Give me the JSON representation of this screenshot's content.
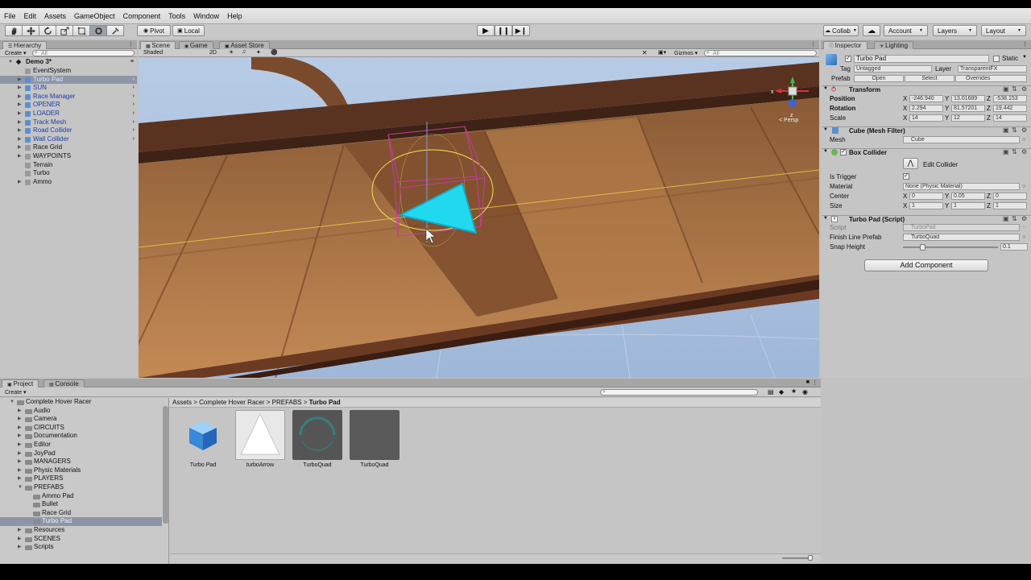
{
  "menu": [
    "File",
    "Edit",
    "Assets",
    "GameObject",
    "Component",
    "Tools",
    "Window",
    "Help"
  ],
  "toolbar": {
    "pivot_label": "Pivot",
    "local_label": "Local",
    "collab_label": "Collab",
    "account_label": "Account",
    "layers_label": "Layers",
    "layout_label": "Layout",
    "tools": [
      "hand-icon",
      "move-icon",
      "rotate-icon",
      "scale-icon",
      "rect-icon",
      "transform-icon"
    ]
  },
  "hierarchy": {
    "tab_label": "Hierarchy",
    "create_label": "Create",
    "search_placeholder": "All",
    "scene_name": "Demo 3*",
    "items": [
      {
        "label": "EventSystem",
        "color": "#111111"
      },
      {
        "label": "Turbo Pad",
        "color": "#1b3fa6"
      },
      {
        "label": "SUN",
        "color": "#1b3fa6"
      },
      {
        "label": "Race Manager",
        "color": "#1b3fa6"
      },
      {
        "label": "OPENER",
        "color": "#1b3fa6"
      },
      {
        "label": "LOADER",
        "color": "#1b3fa6"
      },
      {
        "label": "Track Mesh",
        "color": "#1b3fa6"
      },
      {
        "label": "Road Collider",
        "color": "#1b3fa6"
      },
      {
        "label": "Wall Collider",
        "color": "#1b3fa6"
      },
      {
        "label": "Race Grid",
        "color": "#111111"
      },
      {
        "label": "WAYPOINTS",
        "color": "#111111"
      },
      {
        "label": "Terrain",
        "color": "#111111"
      },
      {
        "label": "Turbo",
        "color": "#111111"
      },
      {
        "label": "Ammo",
        "color": "#111111"
      }
    ]
  },
  "scene_view": {
    "tabs": [
      "Scene",
      "Game",
      "Asset Store"
    ],
    "shading_mode": "Shaded",
    "mode_2d": "2D",
    "gizmos_label": "Gizmos",
    "search_placeholder": "All",
    "persp_label": "< Persp"
  },
  "inspector": {
    "tabs": [
      "Inspector",
      "Lighting"
    ],
    "object_name": "Turbo Pad",
    "static_label": "Static",
    "tag_label": "Tag",
    "tag_value": "Untagged",
    "layer_label": "Layer",
    "layer_value": "TransparentFX",
    "prefab_label": "Prefab",
    "prefab_open": "Open",
    "prefab_select": "Select",
    "prefab_overrides": "Overrides",
    "transform": {
      "title": "Transform",
      "position_label": "Position",
      "rotation_label": "Rotation",
      "scale_label": "Scale",
      "position": [
        "-246.940",
        "13.01689",
        "-538.153"
      ],
      "rotation": [
        "2.294",
        "81.57201",
        "19.442"
      ],
      "scale": [
        "14",
        "12",
        "14"
      ]
    },
    "mesh_filter": {
      "title": "Cube (Mesh Filter)",
      "mesh_label": "Mesh",
      "mesh_value": "Cube"
    },
    "box_collider": {
      "title": "Box Collider",
      "edit_collider_label": "Edit Collider",
      "is_trigger_label": "Is Trigger",
      "material_label": "Material",
      "material_value": "None (Physic Material)",
      "center_label": "Center",
      "size_label": "Size",
      "center": [
        "0",
        "0.05",
        "0"
      ],
      "size": [
        "1",
        "1",
        "1"
      ]
    },
    "turbo_pad_script": {
      "title": "Turbo Pad (Script)",
      "script_label": "Script",
      "script_value": "TurboPad",
      "finish_line_label": "Finish Line Prefab",
      "finish_line_value": "TurboQuad",
      "snap_height_label": "Snap Height",
      "snap_height_value": "0.1",
      "snap_height_fraction": 0.2
    },
    "add_component_label": "Add Component",
    "axis_letters": [
      "X",
      "Y",
      "Z"
    ]
  },
  "project": {
    "tabs": [
      "Project",
      "Console"
    ],
    "create_label": "Create",
    "tree": [
      {
        "label": "Complete Hover Racer",
        "depth": 0,
        "open": true
      },
      {
        "label": "Audio",
        "depth": 1
      },
      {
        "label": "Camera",
        "depth": 1
      },
      {
        "label": "CIRCUITS",
        "depth": 1
      },
      {
        "label": "Documentation",
        "depth": 1
      },
      {
        "label": "Editor",
        "depth": 1
      },
      {
        "label": "JoyPad",
        "depth": 1
      },
      {
        "label": "MANAGERS",
        "depth": 1
      },
      {
        "label": "Physic Materials",
        "depth": 1
      },
      {
        "label": "PLAYERS",
        "depth": 1
      },
      {
        "label": "PREFABS",
        "depth": 1,
        "open": true
      },
      {
        "label": "Ammo Pad",
        "depth": 2
      },
      {
        "label": "Bullet",
        "depth": 2
      },
      {
        "label": "Race Grid",
        "depth": 2
      },
      {
        "label": "Turbo Pad",
        "depth": 2,
        "selected": true
      },
      {
        "label": "Resources",
        "depth": 1
      },
      {
        "label": "SCENES",
        "depth": 1
      },
      {
        "label": "Scripts",
        "depth": 1
      }
    ],
    "breadcrumb": [
      "Assets",
      "Complete Hover Racer",
      "PREFABS",
      "Turbo Pad"
    ],
    "assets": [
      {
        "label": "Turbo Pad",
        "kind": "cube"
      },
      {
        "label": "turboArrow",
        "kind": "arrow"
      },
      {
        "label": "TurboQuad",
        "kind": "ring"
      },
      {
        "label": "TurboQuad",
        "kind": "quad"
      }
    ]
  },
  "colors": {
    "turbo_arrow": "#21d9ef",
    "track": "#a86c3e",
    "sky": "#a9bfdc"
  }
}
